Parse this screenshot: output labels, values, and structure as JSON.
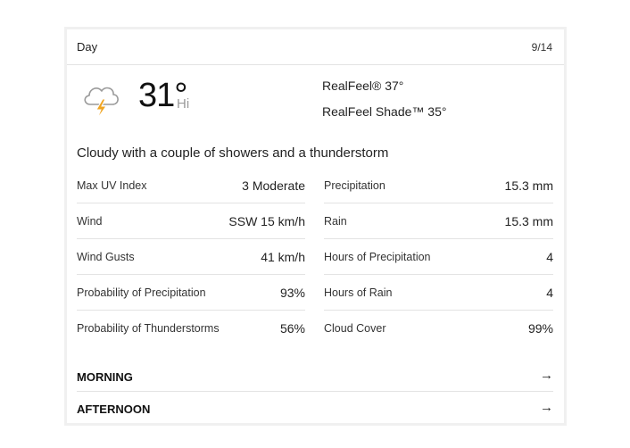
{
  "header": {
    "title": "Day",
    "date": "9/14"
  },
  "current": {
    "icon": "thunderstorm-cloud-icon",
    "temperature": "31°",
    "temperature_label": "Hi",
    "realfeel": "RealFeel® 37°",
    "realfeel_shade": "RealFeel Shade™ 35°",
    "phrase": "Cloudy with a couple of showers and a thunderstorm"
  },
  "details": {
    "left": [
      {
        "label": "Max UV Index",
        "value": "3 Moderate"
      },
      {
        "label": "Wind",
        "value": "SSW 15 km/h"
      },
      {
        "label": "Wind Gusts",
        "value": "41 km/h"
      },
      {
        "label": "Probability of Precipitation",
        "value": "93%"
      },
      {
        "label": "Probability of Thunderstorms",
        "value": "56%"
      }
    ],
    "right": [
      {
        "label": "Precipitation",
        "value": "15.3 mm"
      },
      {
        "label": "Rain",
        "value": "15.3 mm"
      },
      {
        "label": "Hours of Precipitation",
        "value": "4"
      },
      {
        "label": "Hours of Rain",
        "value": "4"
      },
      {
        "label": "Cloud Cover",
        "value": "99%"
      }
    ]
  },
  "sections": [
    {
      "label": "MORNING",
      "arrow": "→"
    },
    {
      "label": "AFTERNOON",
      "arrow": "→"
    }
  ],
  "colors": {
    "icon_cloud": "#9a9a9a",
    "icon_bolt": "#f0a420",
    "divider": "#e3e3e3"
  }
}
